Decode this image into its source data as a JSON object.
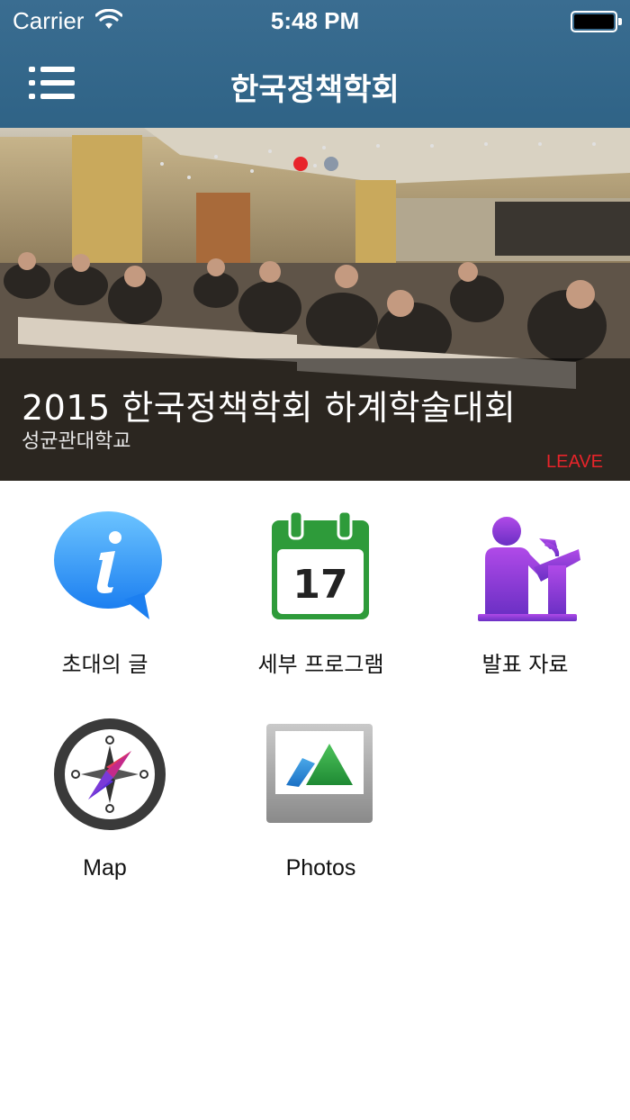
{
  "status_bar": {
    "carrier": "Carrier",
    "time": "5:48 PM"
  },
  "nav": {
    "title": "한국정책학회",
    "menu_icon": "list-menu-icon"
  },
  "hero": {
    "title": "2015 한국정책학회 하계학술대회",
    "subtitle": "성균관대학교",
    "action": "LEAVE",
    "page_count": 2,
    "active_page": 1
  },
  "menu": [
    {
      "label": "초대의 글",
      "icon": "info-bubble-icon"
    },
    {
      "label": "세부 프로그램",
      "icon": "calendar-icon",
      "icon_text": "17"
    },
    {
      "label": "발표 자료",
      "icon": "presenter-podium-icon"
    },
    {
      "label": "Map",
      "icon": "compass-icon"
    },
    {
      "label": "Photos",
      "icon": "photos-icon"
    }
  ],
  "colors": {
    "nav_bar": "#2f6386",
    "accent_red": "#e8242a",
    "calendar_green": "#2e9b3a",
    "presenter_purple": "#8e3fd6"
  }
}
